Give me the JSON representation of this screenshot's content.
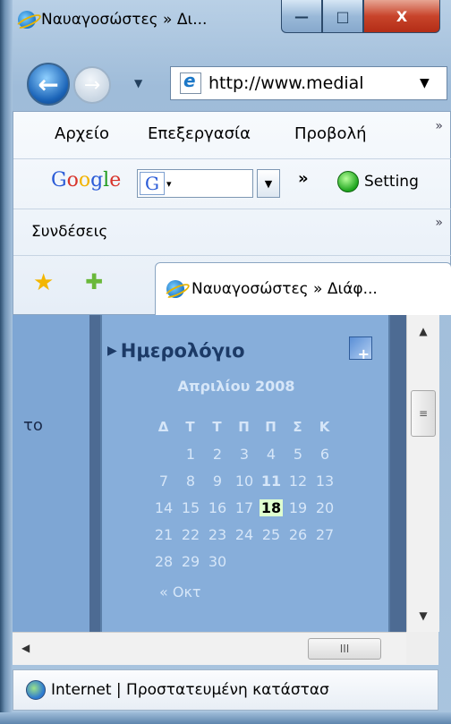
{
  "window": {
    "tab_title": "Ναυαγοσώστες » Δι...",
    "minimize_glyph": "—",
    "maximize_glyph": "□",
    "close_glyph": "X"
  },
  "nav": {
    "back_glyph": "←",
    "forward_glyph": "→",
    "dropdown_glyph": "▼",
    "address_url": "http://www.medial",
    "address_dropdown_glyph": "▼"
  },
  "menubar": {
    "items": [
      "Αρχείο",
      "Επεξεργασία",
      "Προβολή"
    ],
    "overflow": "»"
  },
  "google_bar": {
    "logo_parts": [
      {
        "text": "G",
        "color": "#2a5bd7"
      },
      {
        "text": "o",
        "color": "#d8342b"
      },
      {
        "text": "o",
        "color": "#f2b300"
      },
      {
        "text": "g",
        "color": "#2a5bd7"
      },
      {
        "text": "l",
        "color": "#1e9b1e"
      },
      {
        "text": "e",
        "color": "#d8342b"
      }
    ],
    "search_g": "G",
    "search_arrow": "▾",
    "dropdown_glyph": "▼",
    "overflow": "»",
    "settings_label": "Setting"
  },
  "links_bar": {
    "label": "Συνδέσεις",
    "overflow": "»"
  },
  "favorites_bar": {
    "favorites_star": "★",
    "add_favorite_star": "✚",
    "tab_title": "Ναυαγοσώστες » Διάφ..."
  },
  "content": {
    "left_fragment": "το",
    "calendar": {
      "title": "Ημερολόγιο",
      "month": "Απριλίου 2008",
      "weekdays": [
        "Δ",
        "Τ",
        "Τ",
        "Π",
        "Π",
        "Σ",
        "Κ"
      ],
      "weeks": [
        [
          "",
          "1",
          "2",
          "3",
          "4",
          "5",
          "6"
        ],
        [
          "7",
          "8",
          "9",
          "10",
          "11",
          "12",
          "13"
        ],
        [
          "14",
          "15",
          "16",
          "17",
          "18",
          "19",
          "20"
        ],
        [
          "21",
          "22",
          "23",
          "24",
          "25",
          "26",
          "27"
        ],
        [
          "28",
          "29",
          "30",
          "",
          "",
          "",
          ""
        ]
      ],
      "bold_day": "11",
      "selected_day": "18",
      "prev_link": "« Οκτ"
    }
  },
  "scrollbars": {
    "up": "▲",
    "down": "▼",
    "left": "◀",
    "right": "▶",
    "grip": "≡",
    "hgrip": "III"
  },
  "statusbar": {
    "text": "Internet | Προστατευμένη κατάστασ"
  }
}
